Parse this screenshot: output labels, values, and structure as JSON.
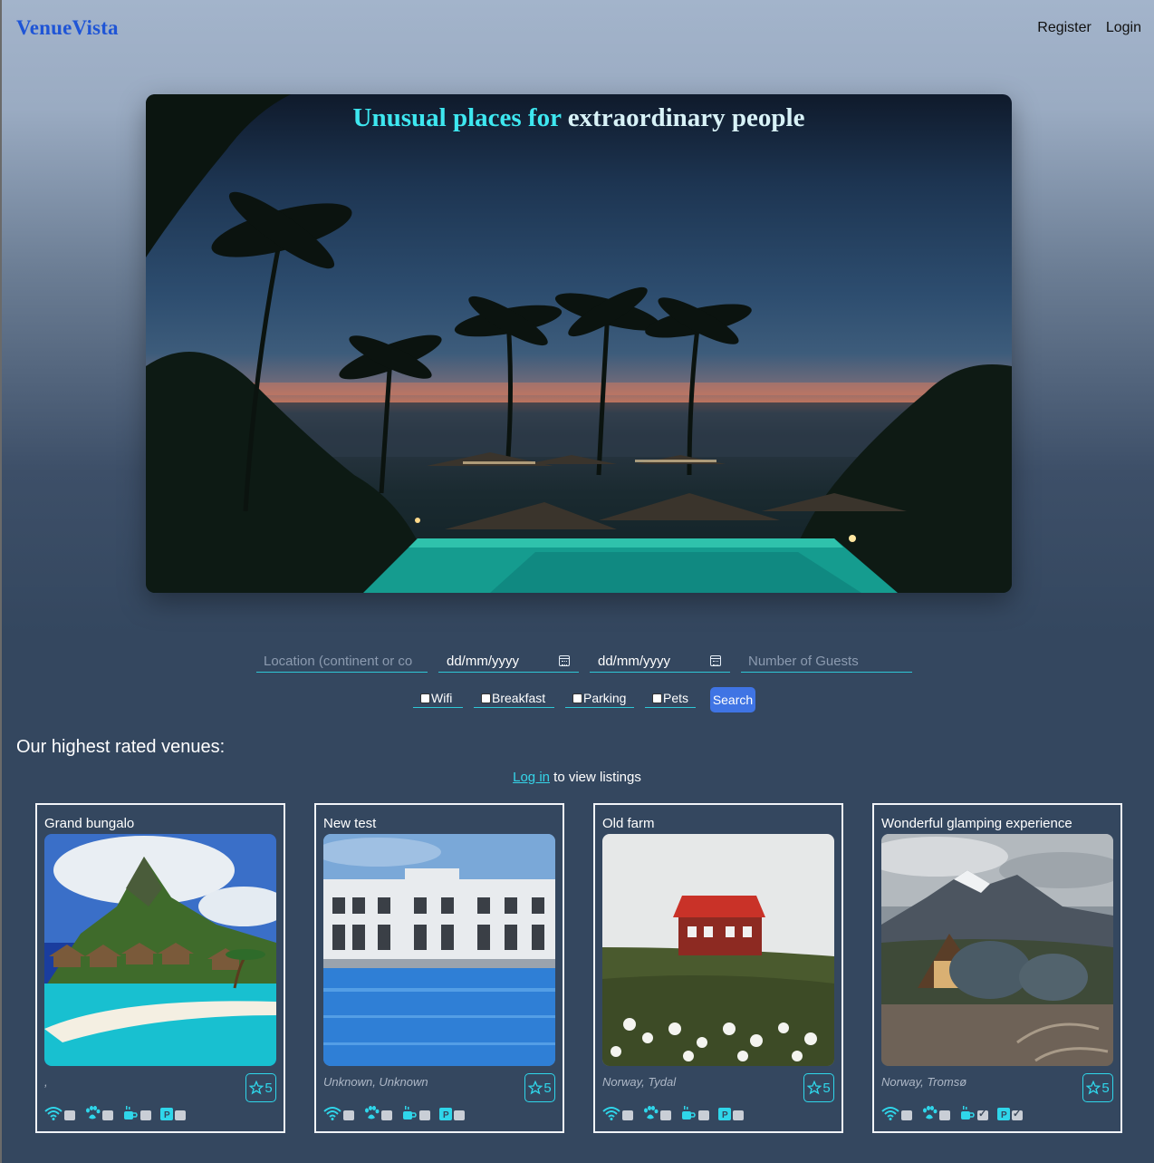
{
  "header": {
    "logo": "VenueVista",
    "nav": {
      "register": "Register",
      "login": "Login"
    }
  },
  "hero": {
    "title_part1": "Unusual places for ",
    "title_part2": "extraordinary people"
  },
  "search": {
    "location_placeholder": "Location (continent or co",
    "date_from": "dd/mm/yyyy",
    "date_to": "dd/mm/yyyy",
    "guests_placeholder": "Number of Guests",
    "filters": {
      "wifi": "Wifi",
      "breakfast": "Breakfast",
      "parking": "Parking",
      "pets": "Pets"
    },
    "search_label": "Search"
  },
  "section": {
    "title": "Our highest rated venues:",
    "login_link": "Log in",
    "login_suffix": " to view listings"
  },
  "venues": [
    {
      "title": "Grand bungalo",
      "location": ",",
      "rating": "5",
      "wifi": false,
      "pets": false,
      "breakfast": false,
      "parking": false
    },
    {
      "title": "New test",
      "location": "Unknown, Unknown",
      "rating": "5",
      "wifi": false,
      "pets": false,
      "breakfast": false,
      "parking": false
    },
    {
      "title": "Old farm",
      "location": "Norway, Tydal",
      "rating": "5",
      "wifi": false,
      "pets": false,
      "breakfast": false,
      "parking": false
    },
    {
      "title": "Wonderful glamping experience",
      "location": "Norway, Tromsø",
      "rating": "5",
      "wifi": false,
      "pets": false,
      "breakfast": true,
      "parking": true
    }
  ],
  "colors": {
    "accent": "#2fd6ea",
    "logo": "#1f55d6",
    "button": "#3f74e4",
    "background": "#34475f"
  }
}
